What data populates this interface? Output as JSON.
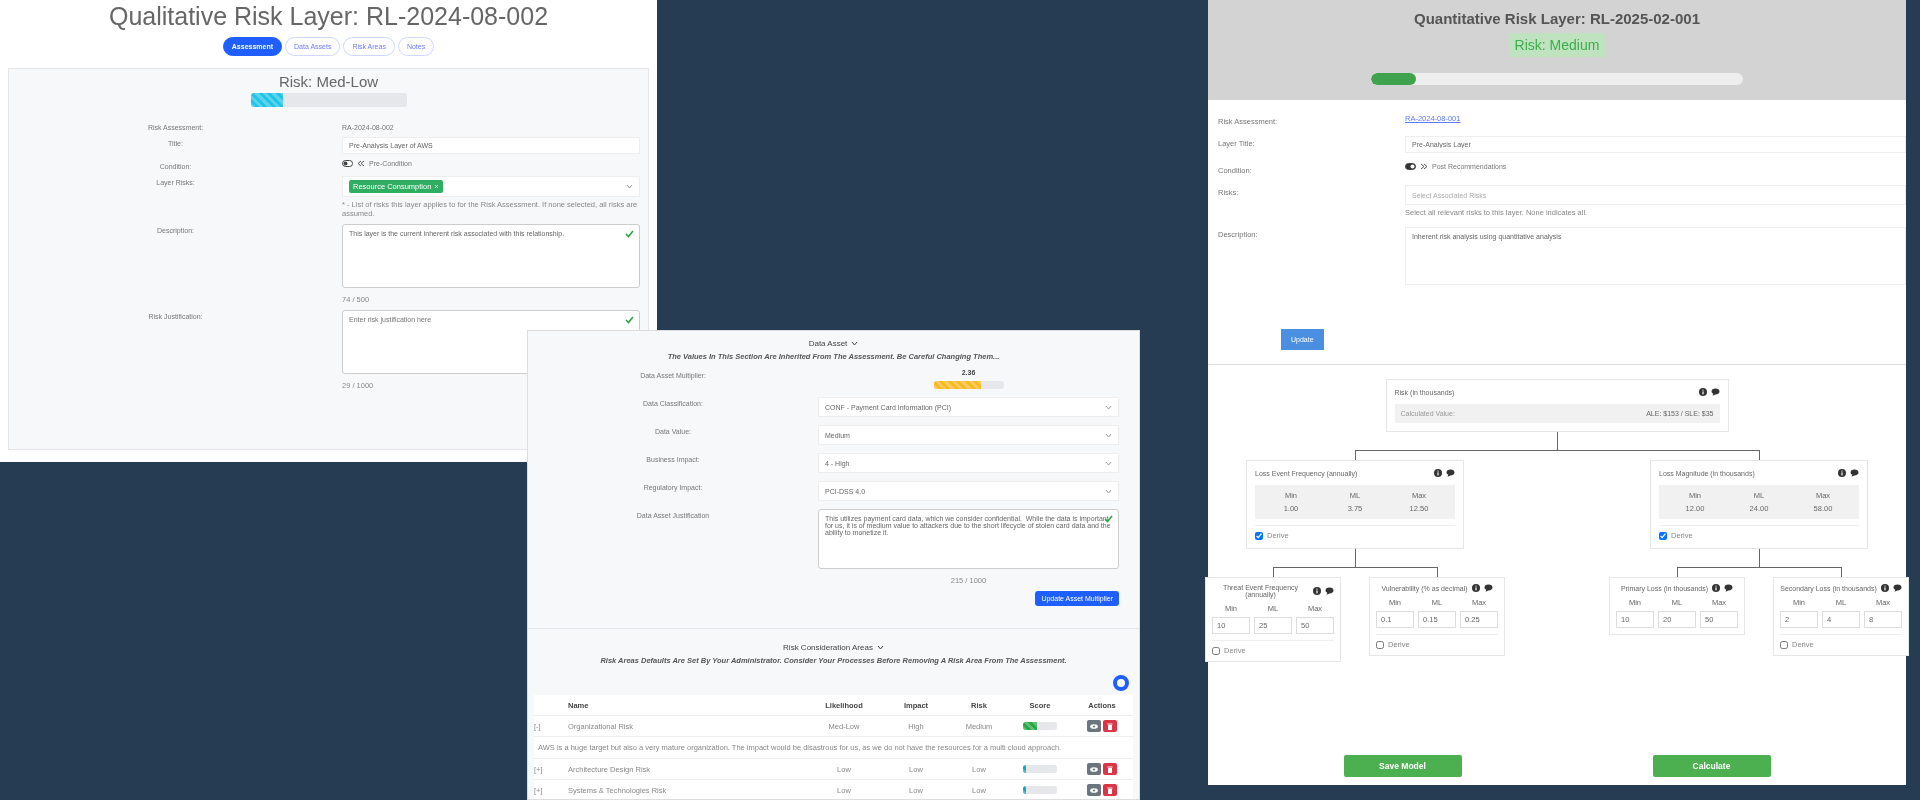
{
  "qualitative_layer": {
    "title": "Qualitative Risk Layer: RL-2024-08-002",
    "tabs": [
      {
        "label": "Assessment",
        "selected": true
      },
      {
        "label": "Data Assets",
        "selected": false
      },
      {
        "label": "Risk Areas",
        "selected": false
      },
      {
        "label": "Notes",
        "selected": false
      }
    ],
    "risk_heading": "Risk: Med-Low",
    "risk_meter": {
      "level": 0.21
    },
    "fields": [
      {
        "kind": "text",
        "label": "Risk Assessment:",
        "value": "RA-2024-08-002"
      },
      {
        "kind": "input",
        "label": "Title:",
        "value": "Pre-Analysis Layer of AWS"
      },
      {
        "kind": "toggle",
        "label": "Condition:",
        "value": "Pre-Condition",
        "on": false
      },
      {
        "kind": "tags",
        "label": "Layer Risks:",
        "tags": [
          "Resource Consumption"
        ],
        "hint": "* - List of risks this layer applies to for the Risk Assessment. If none selected, all risks are assumed."
      },
      {
        "kind": "textarea",
        "label": "Description:",
        "value": "This layer is the current inherent risk associated with this relationship.",
        "count": "74 / 500",
        "valid": true
      },
      {
        "kind": "textarea",
        "label": "Risk Justification:",
        "placeholder": "Enter risk justification here",
        "count": "29 / 1000",
        "valid": true
      }
    ]
  },
  "data_asset_panel": {
    "heading": "Data Asset",
    "note": "The Values In This Section Are Inherited From The Assessment. Be Careful Changing Them...",
    "multiplier_label": "Data Asset Multiplier:",
    "multiplier_value": "2.36",
    "multiplier_meter": {
      "level": 0.68
    },
    "selects": [
      {
        "label": "Data Classification:",
        "value": "CONF - Payment Card Information (PCI)"
      },
      {
        "label": "Data Value:",
        "value": "Medium"
      },
      {
        "label": "Business Impact:",
        "value": "4 - High"
      },
      {
        "label": "Regulatory Impact:",
        "value": "PCI-DSS 4.0"
      }
    ],
    "justification": {
      "label": "Data Asset Justification",
      "value": "This utilizes payment card data, which we consider confidential.  While the data is important for us, it is of medium value to attackers due to the short lifecycle of stolen card data and the ability to monetize it.",
      "count": "215 / 1000",
      "valid": true
    },
    "button": "Update Asset Multiplier"
  },
  "risk_areas": {
    "heading": "Risk Consideration Areas",
    "note": "Risk Areas Defaults Are Set By Your Administrator. Consider Your Processes Before Removing A Risk Area From The Assessment.",
    "columns": [
      "Name",
      "Likelihood",
      "Impact",
      "Risk",
      "Score",
      "Actions"
    ],
    "rows": [
      {
        "toggle": "[-]",
        "name": "Organizational Risk",
        "likelihood": "Med-Low",
        "impact": "High",
        "risk": "Medium",
        "level": 0.4,
        "color": "#28a745",
        "detail": "AWS is a huge target but also a very mature organization. The impact would be disastrous for us, as we do not have the resources for a multi cloud approach."
      },
      {
        "toggle": "[+]",
        "name": "Architecture Design Risk",
        "likelihood": "Low",
        "impact": "Low",
        "risk": "Low",
        "level": 0.03,
        "color": "#17a2b8"
      },
      {
        "toggle": "[+]",
        "name": "Systems & Technologies Risk",
        "likelihood": "Low",
        "impact": "Low",
        "risk": "Low",
        "level": 0.03,
        "color": "#17a2b8"
      }
    ]
  },
  "quantitative_layer": {
    "title": "Quantitative Risk Layer: RL-2025-02-001",
    "risk_badge": "Risk: Medium",
    "ale_meter": {
      "level": 0.12
    },
    "fields": [
      {
        "kind": "link",
        "label": "Risk Assessment:",
        "value": "RA-2024-08-001"
      },
      {
        "kind": "input",
        "label": "Layer Title:",
        "value": "Pre-Analysis Layer"
      },
      {
        "kind": "toggle",
        "label": "Condition:",
        "value": "Post Recommendations",
        "on": true
      },
      {
        "kind": "select",
        "label": "Risks:",
        "placeholder": "Select Associated Risks",
        "hint": "Select all relevant risks to this layer. None indicates all."
      },
      {
        "kind": "textarea",
        "label": "Description:",
        "value": "Inherent risk analysis using quantitative analysis"
      }
    ],
    "update_button": "Update",
    "model": {
      "title": "Risk (in thousands)",
      "calc_label": "Calculated Value:",
      "calc_value": "ALE: $153 / SLE: $35",
      "children": [
        {
          "title": "Loss Event Frequency (annually)",
          "columns": [
            "Min",
            "ML",
            "Max"
          ],
          "values": [
            "1.00",
            "3.75",
            "12.50"
          ],
          "derive": true,
          "derive_label": "Derive",
          "children": [
            {
              "title": "Threat Event Frequency (annually)",
              "columns": [
                "Min",
                "ML",
                "Max"
              ],
              "inputs": [
                "10",
                "25",
                "50"
              ],
              "derive": false,
              "derive_label": "Derive"
            },
            {
              "title": "Vulnerability (% as decimal)",
              "columns": [
                "Min",
                "ML",
                "Max"
              ],
              "inputs": [
                "0.1",
                "0.15",
                "0.25"
              ],
              "derive": false,
              "derive_label": "Derive"
            }
          ]
        },
        {
          "title": "Loss Magnitude (in thousands)",
          "columns": [
            "Min",
            "ML",
            "Max"
          ],
          "values": [
            "12.00",
            "24.00",
            "58.00"
          ],
          "derive": true,
          "derive_label": "Derive",
          "children": [
            {
              "title": "Primary Loss (in thousands)",
              "columns": [
                "Min",
                "ML",
                "Max"
              ],
              "inputs": [
                "10",
                "20",
                "50"
              ]
            },
            {
              "title": "Secondary Loss (in thousands)",
              "columns": [
                "Min",
                "ML",
                "Max"
              ],
              "inputs": [
                "2",
                "4",
                "8"
              ],
              "derive": false,
              "derive_label": "Derive"
            }
          ]
        }
      ]
    },
    "buttons": [
      "Save Model",
      "Calculate"
    ]
  }
}
